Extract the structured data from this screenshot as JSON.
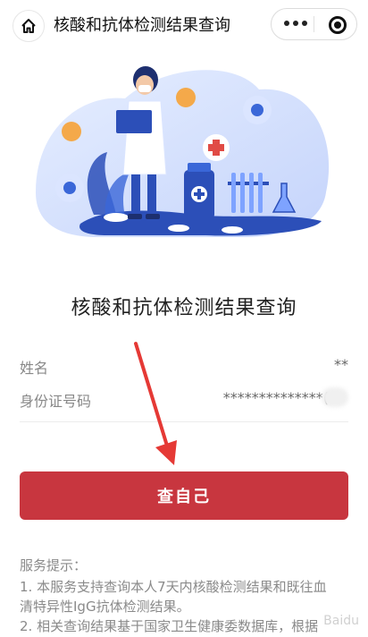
{
  "header": {
    "title": "核酸和抗体检测结果查询"
  },
  "page": {
    "heading": "核酸和抗体检测结果查询"
  },
  "form": {
    "name_label": "姓名",
    "name_value": "**",
    "id_label": "身份证号码",
    "id_value": "**************("
  },
  "actions": {
    "query_label": "查自己"
  },
  "tips": {
    "title": "服务提示：",
    "line1": "1. 本服务支持查询本人7天内核酸检测结果和既往血",
    "line2": "清特异性IgG抗体检测结果。",
    "line3": "2. 相关查询结果基于国家卫生健康委数据库，根据"
  },
  "colors": {
    "primary": "#c8363f",
    "illustration_blue": "#3a67d8"
  },
  "watermark": "Baidu"
}
